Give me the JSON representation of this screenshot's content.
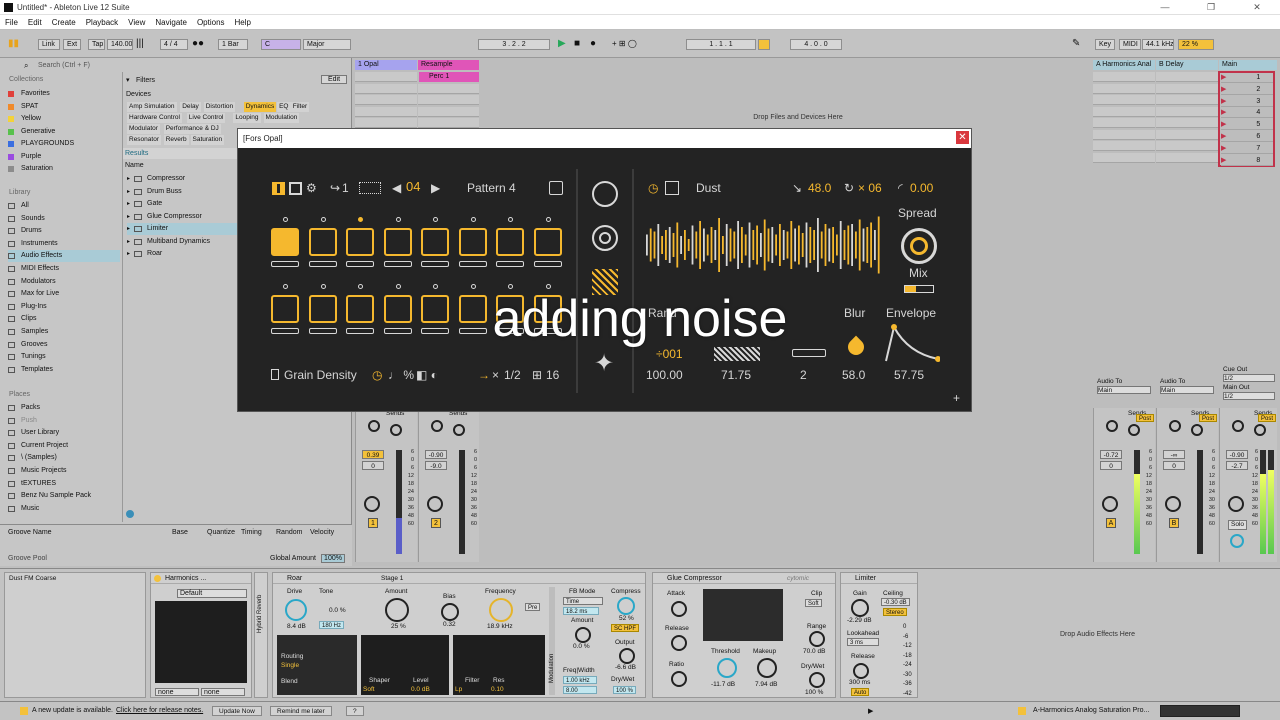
{
  "window": {
    "title": "Untitled* - Ableton Live 12 Suite"
  },
  "menu": [
    "File",
    "Edit",
    "Create",
    "Playback",
    "View",
    "Navigate",
    "Options",
    "Help"
  ],
  "transport": {
    "link": "Link",
    "ext": "Ext",
    "tap": "Tap",
    "tempo": "140.00",
    "signature": "4 / 4",
    "quantize": "1 Bar",
    "key": "C",
    "scale": "Major",
    "position": "3 .  2 .  2",
    "loop_start": "1 .  1 .  1",
    "loop_length": "4 .  0 .  0",
    "key_btn": "Key",
    "midi_btn": "MIDI",
    "sample_rate": "44.1 kHz",
    "cpu": "22 %"
  },
  "browser": {
    "search_placeholder": "Search (Ctrl + F)",
    "collections_title": "Collections",
    "collections": [
      {
        "label": "Favorites",
        "color": "#e0403a"
      },
      {
        "label": "SPAT",
        "color": "#f08a2a"
      },
      {
        "label": "Yellow",
        "color": "#f3d23a"
      },
      {
        "label": "Generative",
        "color": "#58c14c"
      },
      {
        "label": "PLAYGROUNDS",
        "color": "#3a6ee0"
      },
      {
        "label": "Purple",
        "color": "#9a4ce0"
      },
      {
        "label": "Saturation",
        "color": "#8c8c8c"
      }
    ],
    "library_title": "Library",
    "library": [
      "All",
      "Sounds",
      "Drums",
      "Instruments",
      "Audio Effects",
      "MIDI Effects",
      "Modulators",
      "Max for Live",
      "Plug-Ins",
      "Clips",
      "Samples",
      "Grooves",
      "Tunings",
      "Templates"
    ],
    "places_title": "Places",
    "places": [
      "Packs",
      "Push",
      "User Library",
      "Current Project",
      "\\ (Samples)",
      "Music Projects",
      "tEXTURES",
      "Benz Nu Sample Pack",
      "Music"
    ],
    "filters_label": "Filters",
    "edit_label": "Edit",
    "devices_label": "Devices",
    "filter_chips": [
      "Amp Simulation",
      "Delay",
      "Distortion",
      "Dynamics",
      "EQ",
      "Filter",
      "Hardware Control",
      "Live Control",
      "Looping",
      "Modulation",
      "Modulator",
      "Performance & DJ",
      "Resonator",
      "Reverb",
      "Saturation"
    ],
    "results_label": "Results",
    "name_col": "Name",
    "results": [
      "Compressor",
      "Drum Buss",
      "Gate",
      "Glue Compressor",
      "Limiter",
      "Multiband Dynamics",
      "Roar"
    ]
  },
  "groove": {
    "cols": [
      "Groove Name",
      "Base",
      "Quantize",
      "Timing",
      "Random",
      "Velocity"
    ],
    "pool": "Groove Pool",
    "global_amount_label": "Global Amount",
    "global_amount": "100%"
  },
  "session": {
    "tracks": [
      {
        "name": "1 Opal",
        "color": "#a6a3ee"
      },
      {
        "name": "Resample",
        "color": "#e055b8"
      }
    ],
    "returns": [
      {
        "name": "A Harmonics Anal",
        "color": "#a9cbd6"
      },
      {
        "name": "B Delay",
        "color": "#a9cbd6"
      },
      {
        "name": "Main",
        "color": "#a9cbd6"
      }
    ],
    "clip": "Perc 1",
    "drop_hint": "Drop Files and Devices Here",
    "scenes": [
      "1",
      "2",
      "3",
      "4",
      "5",
      "6",
      "7",
      "8"
    ],
    "sends_label": "Sends",
    "audio_to": "Audio To",
    "main": "Main",
    "cue_out": "Cue Out",
    "cue_val": "1/2",
    "main_out": "Main Out",
    "main_out_val": "1/2",
    "post": "Post",
    "solo": "Solo",
    "strips": [
      {
        "vol": "0.39",
        "pan": "0",
        "num": "1"
      },
      {
        "vol": "-0.90",
        "pan": "-9.0",
        "num": "2"
      },
      {
        "vol": "-0.72",
        "pan": "0",
        "num": "A"
      },
      {
        "vol": "-∞",
        "pan": "0",
        "num": "B"
      },
      {
        "vol": "-0.90",
        "pan": "-2.7",
        "num": ""
      }
    ],
    "meter_scale": [
      "6",
      "0",
      "6",
      "12",
      "18",
      "24",
      "30",
      "36",
      "48",
      "60"
    ]
  },
  "devices": {
    "track_name": "Dust FM Coarse",
    "harmonics": {
      "title": "Harmonics ...",
      "preset": "Default",
      "none1": "none",
      "none2": "none",
      "side": "Hybrid Reverb"
    },
    "roar": {
      "title": "Roar",
      "stage": "Stage 1",
      "drive_label": "Drive",
      "drive": "8.4 dB",
      "tone_label": "Tone",
      "tone": "0.0 %",
      "tone_freq": "180 Hz",
      "amount_label": "Amount",
      "amount": "25 %",
      "bias_label": "Bias",
      "bias": "0.32",
      "freq_label": "Frequency",
      "freq": "18.9 kHz",
      "pre": "Pre",
      "routing_label": "Routing",
      "routing": "Single",
      "blend_label": "Blend",
      "shaper_label": "Shaper",
      "shaper": "Soft",
      "level_label": "Level",
      "level": "0.0 dB",
      "filter_label": "Filter",
      "filter": "Lp",
      "res_label": "Res",
      "res": "0.10",
      "fb_mode_label": "FB Mode",
      "fb_mode": "Time",
      "fb_time": "18.2 ms",
      "fb_amount_label": "Amount",
      "fb_amount": "0.0 %",
      "freq_width_label": "Freq|Width",
      "fw1": "1.00 kHz",
      "fw2": "8.00",
      "compress_label": "Compress",
      "compress": "52 %",
      "sc_hpf": "SC HPF",
      "output_label": "Output",
      "output": "-6.6 dB",
      "drywet_label": "Dry/Wet",
      "drywet": "100 %",
      "modulation_label": "Modulation"
    },
    "glue": {
      "title": "Glue Compressor",
      "brand": "cytomic",
      "attack_label": "Attack",
      "release_label": "Release",
      "ratio_label": "Ratio",
      "threshold_label": "Threshold",
      "threshold": "-11.7 dB",
      "makeup_label": "Makeup",
      "makeup": "7.94 dB",
      "clip_label": "Clip",
      "clip": "Soft",
      "range_label": "Range",
      "range": "70.0 dB",
      "drywet_label": "Dry/Wet",
      "drywet": "100 %"
    },
    "limiter": {
      "title": "Limiter",
      "gain_label": "Gain",
      "gain": "-2.29 dB",
      "ceiling_label": "Ceiling",
      "ceiling": "-0.30 dB",
      "stereo": "Stereo",
      "lookahead_label": "Lookahead",
      "lookahead": "3 ms",
      "release_label": "Release",
      "release": "300 ms",
      "auto": "Auto",
      "scale": [
        "0",
        "-6",
        "-12",
        "-18",
        "-24",
        "-30",
        "-36",
        "-42"
      ]
    },
    "drop_hint": "Drop Audio Effects Here"
  },
  "statusbar": {
    "msg": "A new update is available.",
    "link": "Click here for release notes.",
    "update_now": "Update Now",
    "remind": "Remind me later",
    "help": "?",
    "right_device": "A-Harmonics Analog Saturation Pro..."
  },
  "plugin": {
    "title": "[Fors Opal]",
    "step_div": "1",
    "length": "04",
    "pattern": "Pattern 4",
    "pads_row1_on": [
      true,
      false,
      false,
      false,
      false,
      false,
      false,
      false
    ],
    "dots_row1_on": [
      false,
      false,
      true,
      false,
      false,
      false,
      false,
      false
    ],
    "grain_density": "Grain Density",
    "rate": "1/2",
    "steps": "16",
    "dust": "Dust",
    "pitch": "48.0",
    "repeat": "× 06",
    "slope": "0.00",
    "spread": "Spread",
    "mix": "Mix",
    "blur": "Blur",
    "envelope": "Envelope",
    "rand_label": "Rand",
    "rand_code": "÷001",
    "values": [
      "100.00",
      "71.75",
      "2",
      "58.0",
      "57.75"
    ],
    "waveform": [
      0.35,
      0.55,
      0.45,
      0.7,
      0.3,
      0.5,
      0.6,
      0.4,
      0.75,
      0.3,
      0.5,
      0.2,
      0.65,
      0.45,
      0.8,
      0.55,
      0.35,
      0.6,
      0.5,
      0.9,
      0.3,
      0.7,
      0.55,
      0.45,
      0.8,
      0.6,
      0.35,
      0.75,
      0.5,
      0.65,
      0.4,
      0.85,
      0.55,
      0.6,
      0.35,
      0.7,
      0.5,
      0.45,
      0.8,
      0.55,
      0.65,
      0.4,
      0.75,
      0.6,
      0.5,
      0.9,
      0.45,
      0.7,
      0.55,
      0.6,
      0.35,
      0.8,
      0.5,
      0.65,
      0.7,
      0.45,
      0.85,
      0.55,
      0.6,
      0.75,
      0.5,
      0.95
    ],
    "plus": "+"
  },
  "caption": "adding noise"
}
